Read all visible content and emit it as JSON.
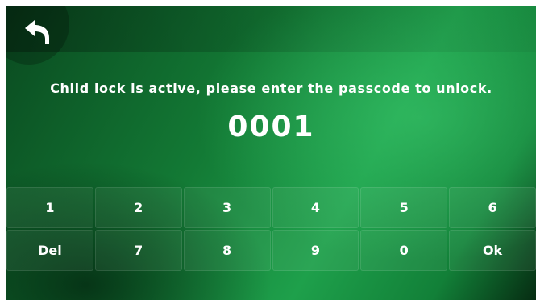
{
  "message": "Child lock is active, please enter the passcode to unlock.",
  "passcode": "0001",
  "keypad": {
    "keys": [
      {
        "label": "1",
        "name": "key-1"
      },
      {
        "label": "2",
        "name": "key-2"
      },
      {
        "label": "3",
        "name": "key-3"
      },
      {
        "label": "4",
        "name": "key-4"
      },
      {
        "label": "5",
        "name": "key-5"
      },
      {
        "label": "6",
        "name": "key-6"
      },
      {
        "label": "Del",
        "name": "delete-key"
      },
      {
        "label": "7",
        "name": "key-7"
      },
      {
        "label": "8",
        "name": "key-8"
      },
      {
        "label": "9",
        "name": "key-9"
      },
      {
        "label": "0",
        "name": "key-0"
      },
      {
        "label": "Ok",
        "name": "ok-key"
      }
    ]
  },
  "icons": {
    "back": "back-arrow-icon"
  }
}
